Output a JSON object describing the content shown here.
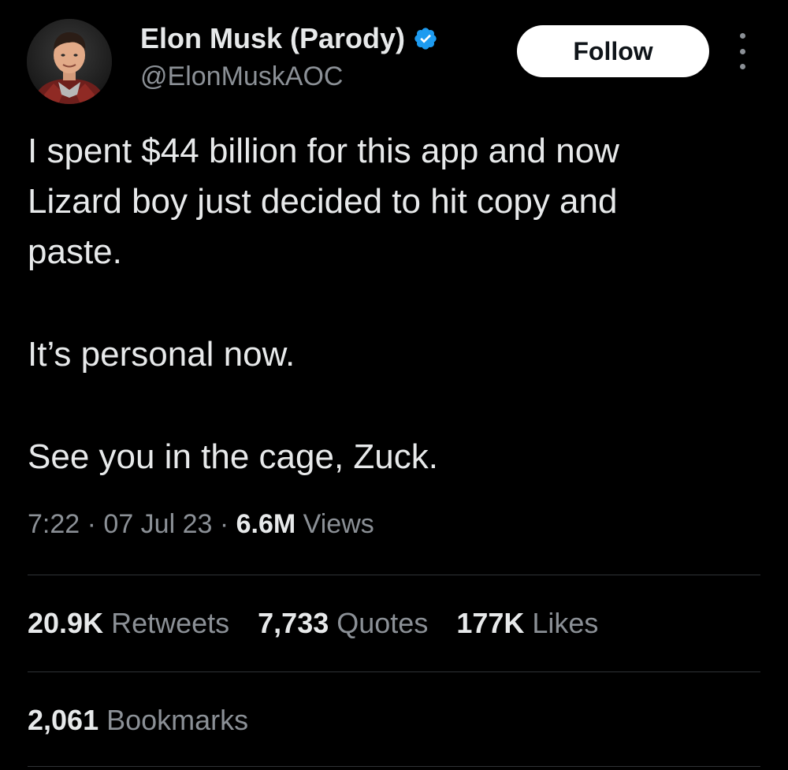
{
  "author": {
    "display_name": "Elon Musk (Parody)",
    "handle": "@ElonMuskAOC",
    "verified_icon": "verified-badge-icon",
    "verified_color": "#1d9bf0"
  },
  "actions": {
    "follow_label": "Follow",
    "more_icon": "more-vertical-icon"
  },
  "tweet": {
    "paragraph1_line1": "I spent $44 billion for this app and now",
    "paragraph1_line2": "Lizard boy just decided to hit copy and",
    "paragraph1_line3": "paste.",
    "paragraph2": "It’s personal now.",
    "paragraph3": "See you in the cage, Zuck."
  },
  "meta": {
    "time": "7:22",
    "separator": " · ",
    "date": "07 Jul 23",
    "views_count": "6.6M",
    "views_label": " Views"
  },
  "stats": {
    "retweets_count": "20.9K",
    "retweets_label": " Retweets",
    "quotes_count": "7,733",
    "quotes_label": " Quotes",
    "likes_count": "177K",
    "likes_label": " Likes",
    "bookmarks_count": "2,061",
    "bookmarks_label": " Bookmarks"
  },
  "colors": {
    "background": "#000000",
    "primary_text": "#e7e9ea",
    "secondary_text": "#8b9096",
    "divider": "#2f3336",
    "follow_button_bg": "#ffffff"
  }
}
